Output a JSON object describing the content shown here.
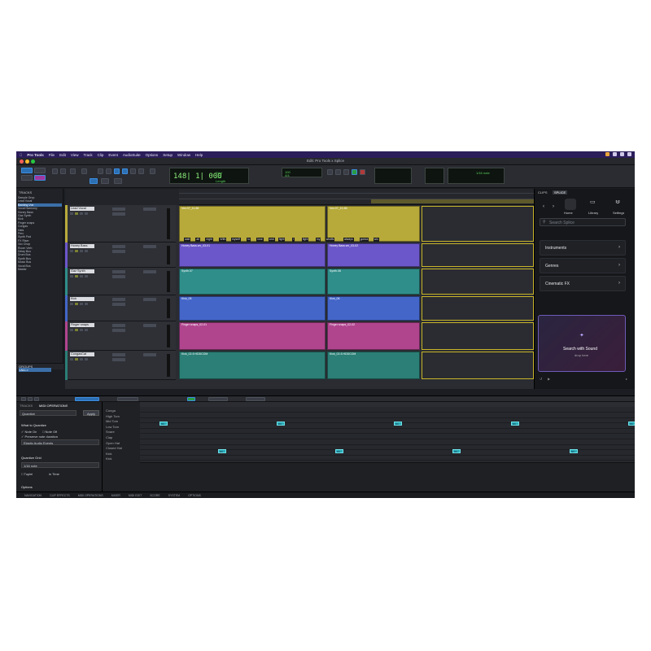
{
  "menubar": {
    "app": "Pro Tools",
    "items": [
      "File",
      "Edit",
      "View",
      "Track",
      "Clip",
      "Event",
      "AudioSuite",
      "Options",
      "Setup",
      "Window",
      "Help"
    ]
  },
  "window": {
    "title": "Edit: Pro Tools x Splice"
  },
  "toolbar": {
    "counter": "148| 1| 000",
    "grid_value": "1/16 note",
    "tempo": "100",
    "meter": "4/4"
  },
  "tracks_panel": {
    "title": "TRACKS",
    "rows": [
      "Sample Drop",
      "Lead Vocal",
      "Backing Vox",
      "Vocal Harmony",
      "Honey Bass",
      "Gaz Synth",
      "Kick",
      "Finger snaps",
      "Congas",
      "Hats",
      "Perc",
      "Synth Pad",
      "FX Riser",
      "Vox Chop",
      "Room Verb",
      "Delay Bus",
      "Drum Bus",
      "Synth Bus",
      "Music Bus",
      "Vocal Bus",
      "Master"
    ],
    "selected_index": 2,
    "groups_label": "GROUPS",
    "groups_item": "<ALL>"
  },
  "edit": {
    "tracks": [
      {
        "name": "Lead Vocal",
        "color": "#b7aa3a"
      },
      {
        "name": "Honey Bass",
        "color": "#6b57c9"
      },
      {
        "name": "Gaz Synth",
        "color": "#2f8e8a"
      },
      {
        "name": "Kick",
        "color": "#4466c9"
      },
      {
        "name": "Finger snaps",
        "color": "#b0458e"
      },
      {
        "name": "CongasCat",
        "color": "#2b7f76"
      }
    ],
    "clips": {
      "vocal": [
        "Vox.07_11-66",
        "Vox.07_10-66"
      ],
      "bass": [
        "Honey Bass.wv_03-01",
        "Honey Bass.wv_03-02"
      ],
      "synth": [
        "Synth.07",
        "Synth.08"
      ],
      "kick": [
        "Kick_05",
        "Kick_06"
      ],
      "snaps": [
        "Finger snaps_02-01",
        "Finger snaps_02-02"
      ],
      "congas": [
        "Kick_02-5 HDDCOM",
        "Kick_02-5 HDDCOM"
      ]
    },
    "lyrics": [
      "wait",
      "all",
      "night",
      "With",
      "myself",
      "to",
      "lose",
      "and",
      "fight",
      "I",
      "fight",
      "my",
      "wistlfs",
      "always",
      "gonna",
      "win"
    ]
  },
  "splice": {
    "tabs": [
      "CLIPS",
      "SPLICE"
    ],
    "nav": [
      "Home",
      "Library",
      "Settings"
    ],
    "search_placeholder": "Search Splice",
    "rows": [
      "Instruments",
      "Genres",
      "Cinematic FX"
    ],
    "drop_title": "Search with Sound",
    "drop_sub": "drop here"
  },
  "midi_ops": {
    "tabs": [
      "TRACKS",
      "MIDI OPERATIONS"
    ],
    "mode": "Quantize",
    "apply": "Apply",
    "what_label": "What to Quantize",
    "note_on": "Note On",
    "note_off": "Note Off",
    "preserve": "Preserve note duration",
    "events": "Elastic Audio Events",
    "grid_label": "Quantize Grid",
    "grid_value": "1/16 note",
    "tuplet": "Tuplet",
    "in_time": "in Time",
    "options": "Options"
  },
  "midi_lanes": [
    "Conga",
    "High Tom",
    "Mid Tom",
    "Low Tom",
    "Snare",
    "Clap",
    "Open Hat",
    "Closed Hat",
    "Kick",
    "Kick"
  ],
  "note_label": "C1",
  "status": [
    "NAVIGATION",
    "CLIP EFFECTS",
    "MIDI OPERATIONS",
    "MIXER",
    "MIDI EDIT",
    "SCORE",
    "SYSTEM",
    "OPTIONS"
  ]
}
